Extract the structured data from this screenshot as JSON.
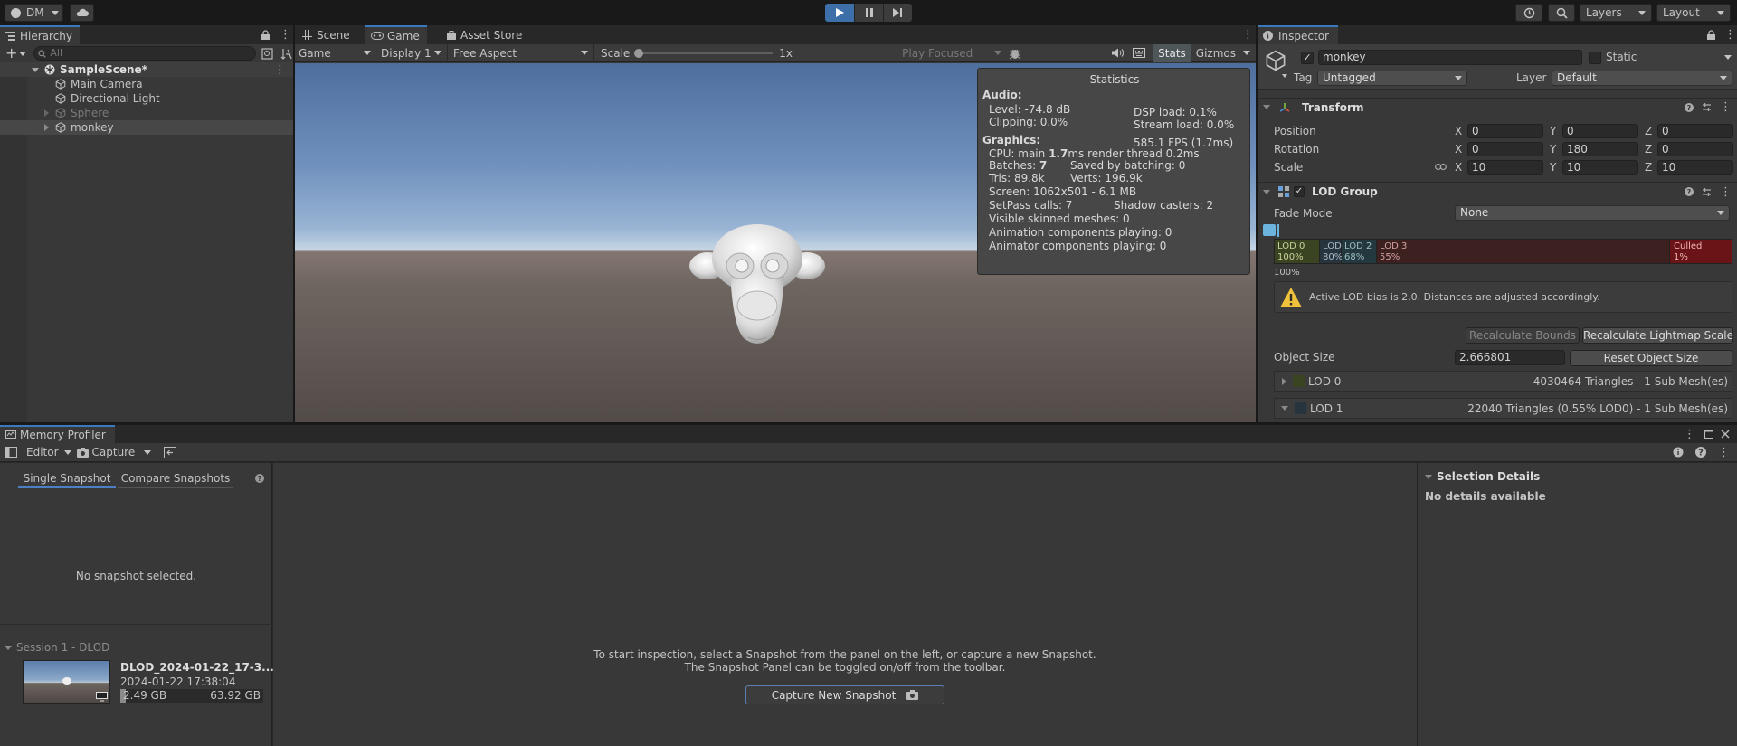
{
  "toolbar": {
    "account": "DM",
    "layers": "Layers",
    "layout": "Layout"
  },
  "hierarchy": {
    "tab": "Hierarchy",
    "search_placeholder": "All",
    "scene": "SampleScene*",
    "items": [
      {
        "label": "Main Camera",
        "dim": false
      },
      {
        "label": "Directional Light",
        "dim": false
      },
      {
        "label": "Sphere",
        "dim": true
      },
      {
        "label": "monkey",
        "dim": false
      }
    ]
  },
  "game": {
    "tabs": [
      "Scene",
      "Game",
      "Asset Store"
    ],
    "mode": "Game",
    "display": "Display 1",
    "aspect": "Free Aspect",
    "scale_label": "Scale",
    "scale_value": "1x",
    "scale_fraction": 0,
    "play_focused": "Play Focused",
    "stats": "Stats",
    "gizmos": "Gizmos"
  },
  "statistics": {
    "title": "Statistics",
    "audio_header": "Audio:",
    "level": "Level: -74.8 dB",
    "dsp": "DSP load: 0.1%",
    "clipping": "Clipping: 0.0%",
    "stream": "Stream load: 0.0%",
    "graphics_header": "Graphics:",
    "fps": "585.1 FPS (1.7ms)",
    "cpu_prefix": "CPU: main ",
    "cpu_main": "1.7",
    "cpu_suffix": "ms  render thread 0.2ms",
    "batches_prefix": "Batches: ",
    "batches": "7",
    "saved": "Saved by batching: 0",
    "tris": "Tris: 89.8k",
    "verts": "Verts: 196.9k",
    "screen": "Screen: 1062x501 - 6.1 MB",
    "setpass": "SetPass calls: 7",
    "shadow": "Shadow casters: 2",
    "skinned": "Visible skinned meshes: 0",
    "animation": "Animation components playing: 0",
    "animator": "Animator components playing: 0"
  },
  "inspector": {
    "tab": "Inspector",
    "object_name": "monkey",
    "static": "Static",
    "tag_label": "Tag",
    "tag": "Untagged",
    "layer_label": "Layer",
    "layer": "Default",
    "transform": {
      "title": "Transform",
      "position_label": "Position",
      "rotation_label": "Rotation",
      "scale_label": "Scale",
      "axis": [
        "X",
        "Y",
        "Z"
      ],
      "position": [
        "0",
        "0",
        "0"
      ],
      "rotation": [
        "0",
        "180",
        "0"
      ],
      "scale": [
        "10",
        "10",
        "10"
      ]
    },
    "lod": {
      "title": "LOD Group",
      "fade_label": "Fade Mode",
      "fade_value": "None",
      "bands": [
        {
          "name": "LOD 0",
          "pct": "100%",
          "color": "#3a4422",
          "text": "#c9d49a"
        },
        {
          "name": "LOD 1",
          "pct": "80%",
          "color": "#27333d",
          "text": "#a9bccb"
        },
        {
          "name": "LOD 2",
          "pct": "68%",
          "color": "#23393f",
          "text": "#9dbec4"
        },
        {
          "name": "LOD 3",
          "pct": "55%",
          "color": "#3d2020",
          "text": "#d4a3a3"
        },
        {
          "name": "Culled",
          "pct": "1%",
          "color": "#6a1417",
          "text": "#f0b5b5"
        }
      ],
      "bar_start": "100%",
      "warning": "Active LOD bias is 2.0. Distances are adjusted accordingly.",
      "recalc_bounds": "Recalculate Bounds",
      "recalc_lightmap": "Recalculate Lightmap Scale",
      "object_size_label": "Object Size",
      "object_size": "2.666801",
      "reset_size": "Reset Object Size",
      "rows": [
        {
          "name": "LOD 0",
          "info": "4030464 Triangles  - 1 Sub Mesh(es)"
        },
        {
          "name": "LOD 1",
          "info": "22040 Triangles (0.55% LOD0) - 1 Sub Mesh(es)"
        }
      ]
    }
  },
  "memory": {
    "tab": "Memory Profiler",
    "editor": "Editor",
    "capture": "Capture",
    "tab_single": "Single Snapshot",
    "tab_compare": "Compare Snapshots",
    "no_snapshot": "No snapshot selected.",
    "session": "Session 1 - DLOD",
    "snapshot_name": "DLOD_2024-01-22_17-3...",
    "snapshot_date": "2024-01-22 17:38:04",
    "snapshot_used": "2.49 GB",
    "snapshot_total": "63.92 GB",
    "hint_1": "To start inspection, select a Snapshot from the panel on the left, or capture a new Snapshot.",
    "hint_2": "The Snapshot Panel can be toggled on/off from the toolbar.",
    "capture_new": "Capture New Snapshot",
    "selection_details": "Selection Details",
    "no_details": "No details available"
  },
  "colors": {
    "play_blue": "#3d6fa8",
    "accent_blue": "#4c7fc4"
  }
}
